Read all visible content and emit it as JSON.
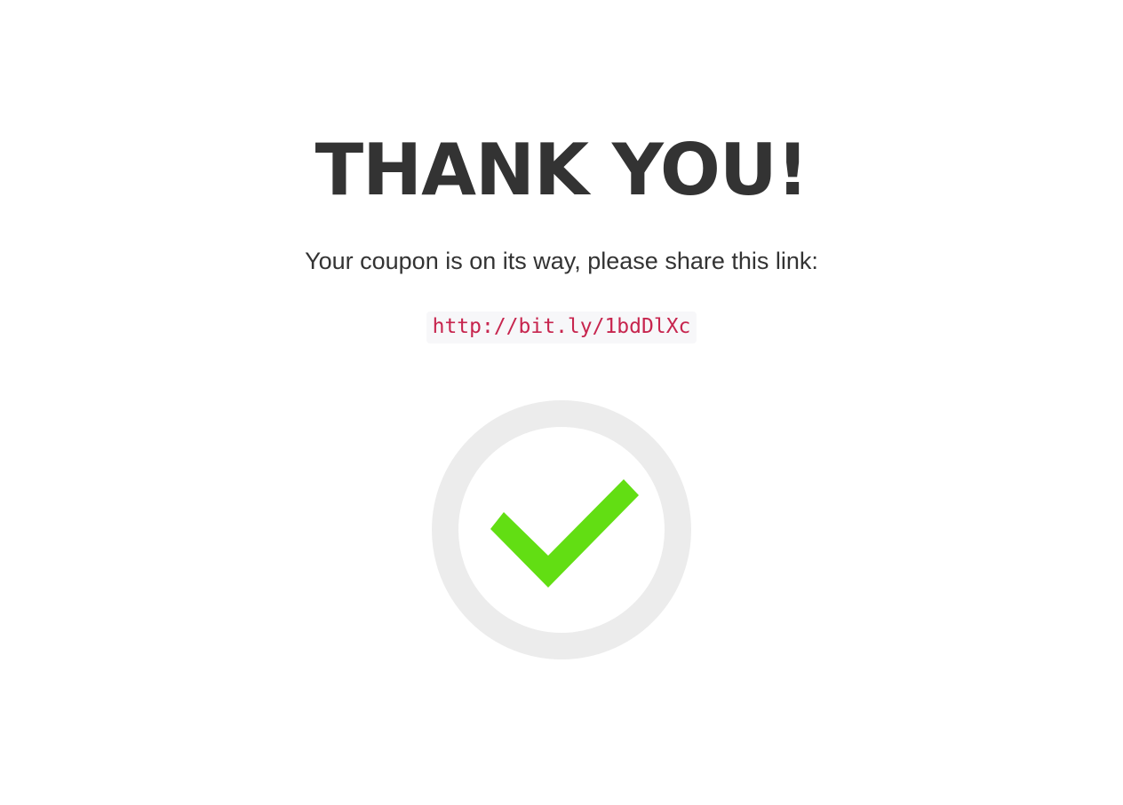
{
  "heading": "THANK YOU!",
  "message": "Your coupon is on its way, please share this link:",
  "share_link": "http://bit.ly/1bdDlXc",
  "icons": {
    "success": "check-circle-icon"
  },
  "colors": {
    "text": "#333333",
    "link": "#c7254e",
    "link_background": "#f7f7f9",
    "ring": "#ececec",
    "check": "#62de13"
  }
}
